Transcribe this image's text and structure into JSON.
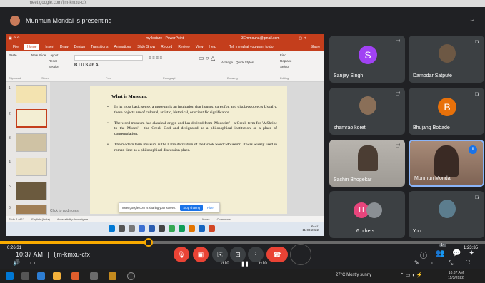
{
  "browser": {
    "url": "meet.google.com/ljm-kmxu-cfx"
  },
  "presenter_bar": {
    "text": "Munmun Mondal is presenting"
  },
  "powerpoint": {
    "doc_title": "my lecture - PowerPoint",
    "account": "3Emmouna@gmail.com",
    "tabs": [
      "File",
      "Home",
      "Insert",
      "Draw",
      "Design",
      "Transitions",
      "Animations",
      "Slide Show",
      "Record",
      "Review",
      "View",
      "Help"
    ],
    "active_tab": "Home",
    "tell_me": "Tell me what you want to do",
    "share": "Share",
    "ribbon_groups": [
      "Clipboard",
      "Slides",
      "Font",
      "Paragraph",
      "Drawing",
      "Editing"
    ],
    "ribbon_items": {
      "paste": "Paste",
      "new_slide": "New Slide",
      "layout": "Layout",
      "reset": "Reset",
      "section": "Section",
      "arrange": "Arrange",
      "quick_styles": "Quick Styles",
      "find": "Find",
      "replace": "Replace",
      "select": "Select"
    },
    "slide_numbers": [
      "1",
      "2",
      "3",
      "4",
      "5",
      "6"
    ],
    "slide": {
      "heading": "What is Museum:",
      "bullets": [
        "In its most basic sense, a museum is an institution that houses, cares for, and displays objects Usually, these objects are of cultural, artistic, historical, or scientific significance.",
        "The word museum has classical origin and has derived from 'Mouseim' - a Greek term for 'A Shrine to the Muses' - the Greek God and designated as a philosophical institution or a place of contemplation.",
        "The modern term museum is the Latin derivation of the Greek word 'Mouseim'. It was widely used in roman time as a philosophical discussion place."
      ]
    },
    "notes": "Click to add notes",
    "status": {
      "slide_of": "Slide 2 of 12",
      "language": "English (India)",
      "accessibility": "Accessibility: Investigate",
      "notes_btn": "Notes",
      "comments_btn": "Comments"
    },
    "share_popup": {
      "text": "meet.google.com is sharing your screen.",
      "stop": "Stop sharing",
      "hide": "Hide"
    },
    "mini_clock": {
      "time": "10:37",
      "date": "11-03-2022"
    }
  },
  "participants": [
    {
      "name": "Sanjay Singh",
      "letter": "S",
      "color": "#a142f4"
    },
    {
      "name": "Damodar Satpute"
    },
    {
      "name": "shamrao koreti"
    },
    {
      "name": "Bhujang Bobade",
      "letter": "B",
      "color": "#e8710a"
    },
    {
      "name": "Sachin Bhogekar"
    },
    {
      "name": "Munmun Mondal"
    },
    {
      "name": "6 others",
      "letter": "H",
      "color": "#e8457c"
    },
    {
      "name": "You"
    }
  ],
  "playback": {
    "elapsed": "0:26:31",
    "total": "1:23:35",
    "progress": 0.306
  },
  "meeting": {
    "time": "10:37 AM",
    "separator": "|",
    "code": "ljm-kmxu-cfx"
  },
  "controls": {
    "rewind": "10",
    "forward": "10",
    "participants_badge": "14"
  },
  "taskbar": {
    "weather": "27°C  Mostly sunny",
    "time": "10:37 AM",
    "date": "11/3/2022"
  },
  "colors": {
    "accent": "#8ab4f8",
    "danger": "#ea4335",
    "ppt": "#c43e1c",
    "progress": "#f9ab00"
  }
}
